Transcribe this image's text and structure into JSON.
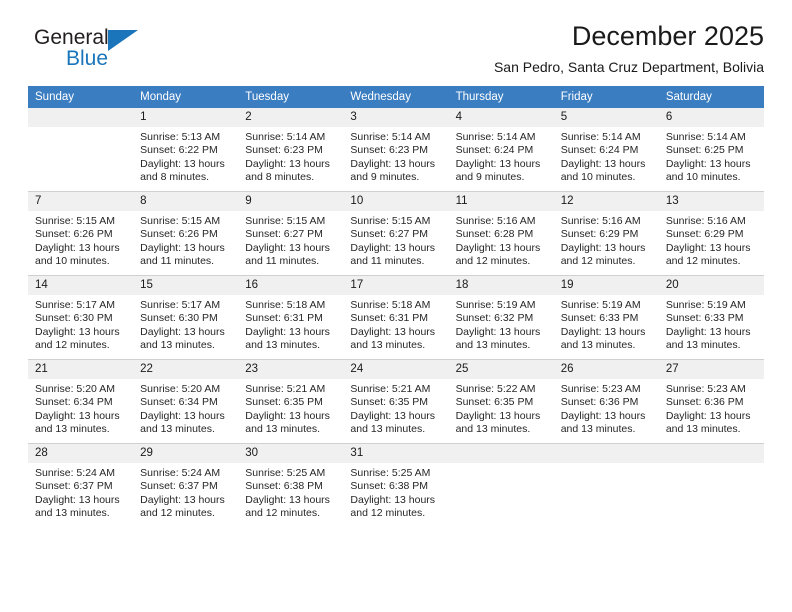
{
  "brand": {
    "name_top": "General",
    "name_bottom": "Blue",
    "triangle_color": "#1b75bb"
  },
  "header": {
    "title": "December 2025",
    "subtitle": "San Pedro, Santa Cruz Department, Bolivia"
  },
  "theme": {
    "header_bg": "#3b7dc1",
    "header_text": "#ffffff",
    "daynum_bg": "#f0f0f0",
    "row_divider": "#d0d0d0",
    "body_text": "#262626"
  },
  "calendar": {
    "weekday_headers": [
      "Sunday",
      "Monday",
      "Tuesday",
      "Wednesday",
      "Thursday",
      "Friday",
      "Saturday"
    ],
    "weeks": [
      [
        {
          "day": "",
          "empty": true,
          "sunrise": "",
          "sunset": "",
          "daylight": ""
        },
        {
          "day": "1",
          "sunrise": "Sunrise: 5:13 AM",
          "sunset": "Sunset: 6:22 PM",
          "daylight": "Daylight: 13 hours and 8 minutes."
        },
        {
          "day": "2",
          "sunrise": "Sunrise: 5:14 AM",
          "sunset": "Sunset: 6:23 PM",
          "daylight": "Daylight: 13 hours and 8 minutes."
        },
        {
          "day": "3",
          "sunrise": "Sunrise: 5:14 AM",
          "sunset": "Sunset: 6:23 PM",
          "daylight": "Daylight: 13 hours and 9 minutes."
        },
        {
          "day": "4",
          "sunrise": "Sunrise: 5:14 AM",
          "sunset": "Sunset: 6:24 PM",
          "daylight": "Daylight: 13 hours and 9 minutes."
        },
        {
          "day": "5",
          "sunrise": "Sunrise: 5:14 AM",
          "sunset": "Sunset: 6:24 PM",
          "daylight": "Daylight: 13 hours and 10 minutes."
        },
        {
          "day": "6",
          "sunrise": "Sunrise: 5:14 AM",
          "sunset": "Sunset: 6:25 PM",
          "daylight": "Daylight: 13 hours and 10 minutes."
        }
      ],
      [
        {
          "day": "7",
          "sunrise": "Sunrise: 5:15 AM",
          "sunset": "Sunset: 6:26 PM",
          "daylight": "Daylight: 13 hours and 10 minutes."
        },
        {
          "day": "8",
          "sunrise": "Sunrise: 5:15 AM",
          "sunset": "Sunset: 6:26 PM",
          "daylight": "Daylight: 13 hours and 11 minutes."
        },
        {
          "day": "9",
          "sunrise": "Sunrise: 5:15 AM",
          "sunset": "Sunset: 6:27 PM",
          "daylight": "Daylight: 13 hours and 11 minutes."
        },
        {
          "day": "10",
          "sunrise": "Sunrise: 5:15 AM",
          "sunset": "Sunset: 6:27 PM",
          "daylight": "Daylight: 13 hours and 11 minutes."
        },
        {
          "day": "11",
          "sunrise": "Sunrise: 5:16 AM",
          "sunset": "Sunset: 6:28 PM",
          "daylight": "Daylight: 13 hours and 12 minutes."
        },
        {
          "day": "12",
          "sunrise": "Sunrise: 5:16 AM",
          "sunset": "Sunset: 6:29 PM",
          "daylight": "Daylight: 13 hours and 12 minutes."
        },
        {
          "day": "13",
          "sunrise": "Sunrise: 5:16 AM",
          "sunset": "Sunset: 6:29 PM",
          "daylight": "Daylight: 13 hours and 12 minutes."
        }
      ],
      [
        {
          "day": "14",
          "sunrise": "Sunrise: 5:17 AM",
          "sunset": "Sunset: 6:30 PM",
          "daylight": "Daylight: 13 hours and 12 minutes."
        },
        {
          "day": "15",
          "sunrise": "Sunrise: 5:17 AM",
          "sunset": "Sunset: 6:30 PM",
          "daylight": "Daylight: 13 hours and 13 minutes."
        },
        {
          "day": "16",
          "sunrise": "Sunrise: 5:18 AM",
          "sunset": "Sunset: 6:31 PM",
          "daylight": "Daylight: 13 hours and 13 minutes."
        },
        {
          "day": "17",
          "sunrise": "Sunrise: 5:18 AM",
          "sunset": "Sunset: 6:31 PM",
          "daylight": "Daylight: 13 hours and 13 minutes."
        },
        {
          "day": "18",
          "sunrise": "Sunrise: 5:19 AM",
          "sunset": "Sunset: 6:32 PM",
          "daylight": "Daylight: 13 hours and 13 minutes."
        },
        {
          "day": "19",
          "sunrise": "Sunrise: 5:19 AM",
          "sunset": "Sunset: 6:33 PM",
          "daylight": "Daylight: 13 hours and 13 minutes."
        },
        {
          "day": "20",
          "sunrise": "Sunrise: 5:19 AM",
          "sunset": "Sunset: 6:33 PM",
          "daylight": "Daylight: 13 hours and 13 minutes."
        }
      ],
      [
        {
          "day": "21",
          "sunrise": "Sunrise: 5:20 AM",
          "sunset": "Sunset: 6:34 PM",
          "daylight": "Daylight: 13 hours and 13 minutes."
        },
        {
          "day": "22",
          "sunrise": "Sunrise: 5:20 AM",
          "sunset": "Sunset: 6:34 PM",
          "daylight": "Daylight: 13 hours and 13 minutes."
        },
        {
          "day": "23",
          "sunrise": "Sunrise: 5:21 AM",
          "sunset": "Sunset: 6:35 PM",
          "daylight": "Daylight: 13 hours and 13 minutes."
        },
        {
          "day": "24",
          "sunrise": "Sunrise: 5:21 AM",
          "sunset": "Sunset: 6:35 PM",
          "daylight": "Daylight: 13 hours and 13 minutes."
        },
        {
          "day": "25",
          "sunrise": "Sunrise: 5:22 AM",
          "sunset": "Sunset: 6:35 PM",
          "daylight": "Daylight: 13 hours and 13 minutes."
        },
        {
          "day": "26",
          "sunrise": "Sunrise: 5:23 AM",
          "sunset": "Sunset: 6:36 PM",
          "daylight": "Daylight: 13 hours and 13 minutes."
        },
        {
          "day": "27",
          "sunrise": "Sunrise: 5:23 AM",
          "sunset": "Sunset: 6:36 PM",
          "daylight": "Daylight: 13 hours and 13 minutes."
        }
      ],
      [
        {
          "day": "28",
          "sunrise": "Sunrise: 5:24 AM",
          "sunset": "Sunset: 6:37 PM",
          "daylight": "Daylight: 13 hours and 13 minutes."
        },
        {
          "day": "29",
          "sunrise": "Sunrise: 5:24 AM",
          "sunset": "Sunset: 6:37 PM",
          "daylight": "Daylight: 13 hours and 12 minutes."
        },
        {
          "day": "30",
          "sunrise": "Sunrise: 5:25 AM",
          "sunset": "Sunset: 6:38 PM",
          "daylight": "Daylight: 13 hours and 12 minutes."
        },
        {
          "day": "31",
          "sunrise": "Sunrise: 5:25 AM",
          "sunset": "Sunset: 6:38 PM",
          "daylight": "Daylight: 13 hours and 12 minutes."
        },
        {
          "day": "",
          "empty": true,
          "sunrise": "",
          "sunset": "",
          "daylight": ""
        },
        {
          "day": "",
          "empty": true,
          "sunrise": "",
          "sunset": "",
          "daylight": ""
        },
        {
          "day": "",
          "empty": true,
          "sunrise": "",
          "sunset": "",
          "daylight": ""
        }
      ]
    ]
  }
}
